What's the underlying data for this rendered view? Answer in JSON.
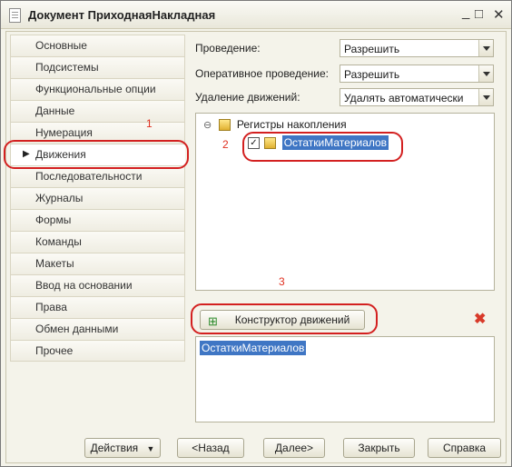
{
  "window": {
    "title": "Документ ПриходнаяНакладная"
  },
  "nav": {
    "items": [
      {
        "label": "Основные"
      },
      {
        "label": "Подсистемы"
      },
      {
        "label": "Функциональные опции"
      },
      {
        "label": "Данные"
      },
      {
        "label": "Нумерация"
      },
      {
        "label": "Движения",
        "active": true
      },
      {
        "label": "Последовательности"
      },
      {
        "label": "Журналы"
      },
      {
        "label": "Формы"
      },
      {
        "label": "Команды"
      },
      {
        "label": "Макеты"
      },
      {
        "label": "Ввод на основании"
      },
      {
        "label": "Права"
      },
      {
        "label": "Обмен данными"
      },
      {
        "label": "Прочее"
      }
    ]
  },
  "settings": {
    "posting_label": "Проведение:",
    "posting_value": "Разрешить",
    "realtime_label": "Оперативное проведение:",
    "realtime_value": "Разрешить",
    "delete_label": "Удаление движений:",
    "delete_value": "Удалять автоматически"
  },
  "tree": {
    "group_label": "Регистры накопления",
    "item_label": "ОстаткиМатериалов"
  },
  "constructor_button": "Конструктор движений",
  "result_list": [
    "ОстаткиМатериалов"
  ],
  "annotations": {
    "n1": "1",
    "n2": "2",
    "n3": "3"
  },
  "footer": {
    "actions": "Действия",
    "back": "<Назад",
    "next": "Далее>",
    "close": "Закрыть",
    "help": "Справка"
  },
  "colors": {
    "annotation": "#d32020",
    "selection": "#3f76c4"
  }
}
